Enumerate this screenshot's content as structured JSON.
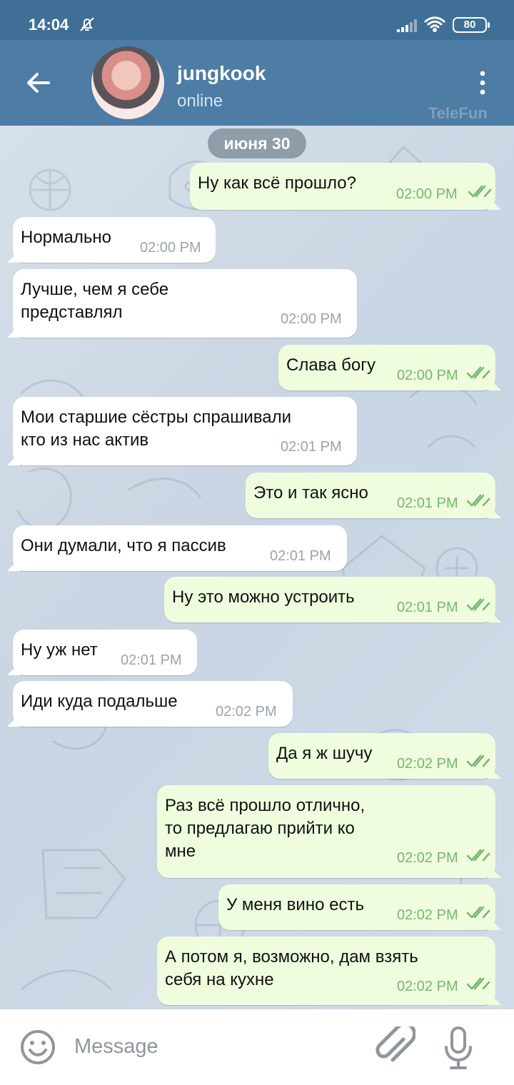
{
  "status": {
    "time": "14:04",
    "battery": "80",
    "icons": [
      "muted-bell-icon",
      "signal-icon",
      "wifi-icon",
      "battery-icon"
    ]
  },
  "header": {
    "back_icon": "back-arrow-icon",
    "contact_name": "jungkook",
    "contact_status": "online",
    "watermark": "TeleFun",
    "menu_icon": "vertical-dots-icon"
  },
  "chat": {
    "date": "июня 30",
    "messages": [
      {
        "text": "Ну как всё прошло?",
        "time": "02:00 PM"
      },
      {
        "text": "Нормально",
        "time": "02:00 PM"
      },
      {
        "text": "Лучше, чем я себе\nпредставлял",
        "time": "02:00 PM"
      },
      {
        "text": "Слава богу",
        "time": "02:00 PM"
      },
      {
        "text": "Мои старшие сёстры спрашивали\nкто из нас актив",
        "time": "02:01 PM"
      },
      {
        "text": "Это и так ясно",
        "time": "02:01 PM"
      },
      {
        "text": "Они думали, что я пассив",
        "time": "02:01 PM"
      },
      {
        "text": "Ну это можно устроить",
        "time": "02:01 PM"
      },
      {
        "text": "Ну уж нет",
        "time": "02:01 PM"
      },
      {
        "text": "Иди куда подальше",
        "time": "02:02 PM"
      },
      {
        "text": "Да я ж шучу",
        "time": "02:02 PM"
      },
      {
        "text": "Раз всё прошло отлично,\nто предлагаю прийти ко\nмне",
        "time": "02:02 PM"
      },
      {
        "text": "У меня вино есть",
        "time": "02:02 PM"
      },
      {
        "text": "А потом я, возможно, дам взять\nсебя на кухне",
        "time": "02:02 PM"
      }
    ]
  },
  "composer": {
    "placeholder": "Message",
    "icons": [
      "emoji-icon",
      "attachment-icon",
      "microphone-icon"
    ]
  },
  "colors": {
    "header": "#4d7ca5",
    "outgoing_bubble": "#effdde",
    "incoming_bubble": "#ffffff",
    "read_check": "#76b76d"
  }
}
